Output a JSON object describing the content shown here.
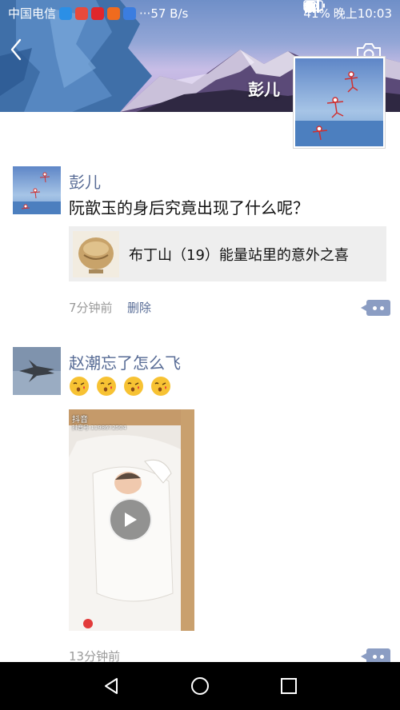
{
  "status_bar": {
    "carrier": "中国电信",
    "network_speed": "···57 B/s",
    "battery": "41%",
    "time": "晚上10:03"
  },
  "header": {
    "back_icon": "chevron-left-icon",
    "camera_icon": "camera-icon",
    "profile_name": "彭儿"
  },
  "posts": [
    {
      "author": "彭儿",
      "text": "阮歆玉的身后究竟出现了什么呢？",
      "link": {
        "title": "布丁山（19）能量站里的意外之喜"
      },
      "time": "7分钟前",
      "delete_label": "删除"
    },
    {
      "author": "赵潮忘了怎么飞",
      "emoji": "kissing-face-icon",
      "emoji_count": 4,
      "video": {
        "platform_label": "抖音",
        "watermark_id": "抖音号:1198672504"
      },
      "time": "13分钟前"
    }
  ],
  "colors": {
    "name_link": "#576b95",
    "timestamp": "#999999",
    "more_button": "#8b9dc3",
    "link_card_bg": "#eeeeee"
  }
}
